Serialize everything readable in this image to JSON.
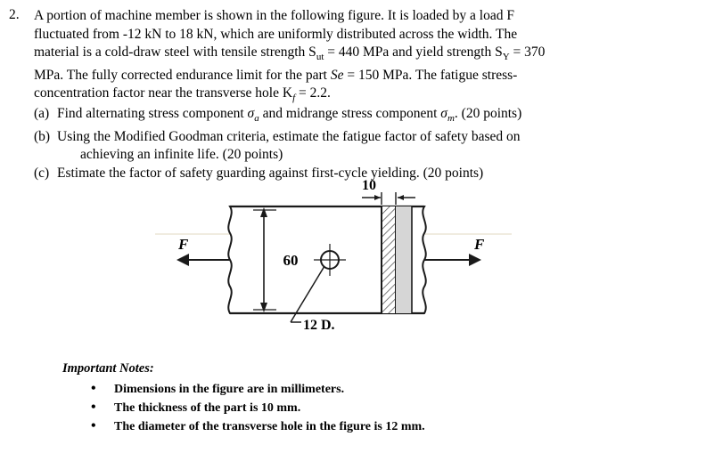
{
  "question": {
    "number": "2.",
    "line1": "A portion of machine member is shown in the following figure. It is loaded by a load F",
    "line2": "fluctuated from -12 kN to 18 kN, which are uniformly distributed across the width. The",
    "line3_a": "material is a cold-draw steel with tensile strength S",
    "line3_sub1": "ut",
    "line3_b": " = 440 MPa and yield strength S",
    "line3_sub2": "Y",
    "line3_c": " = 370",
    "line4_a": "MPa. The fully corrected endurance limit for the part ",
    "line4_se": "Se",
    "line4_b": " = 150 MPa. The fatigue stress-",
    "line5_a": "concentration factor near the transverse hole K",
    "line5_sub": "f",
    "line5_b": " = 2.2.",
    "parts": [
      {
        "label": "(a)",
        "text_a": "Find alternating stress component ",
        "sym_a": "σ",
        "sub_a": "a",
        "text_b": " and midrange stress component ",
        "sym_b": "σ",
        "sub_b": "m",
        "text_c": ". (20 points)",
        "line2": ""
      },
      {
        "label": "(b)",
        "text_a": "Using the Modified Goodman criteria, estimate the fatigue factor of safety based on",
        "line2": "achieving an infinite life. (20 points)"
      },
      {
        "label": "(c)",
        "text_a": "Estimate the factor of safety guarding against first-cycle yielding. (20 points)",
        "line2": ""
      }
    ]
  },
  "figure": {
    "label_thickness": "10",
    "label_width": "60",
    "label_hole": "12 D.",
    "label_force_left": "F",
    "label_force_right": "F",
    "colors": {
      "outline": "#1a1a1a",
      "hatch": "#6b6b6b",
      "band_fill": "#d8d8d8"
    }
  },
  "notes": {
    "title": "Important Notes:",
    "items": [
      "Dimensions in the figure are in millimeters.",
      "The thickness of the part is 10 mm.",
      "The diameter of the transverse hole in the figure is 12 mm."
    ],
    "bullet": "•"
  }
}
